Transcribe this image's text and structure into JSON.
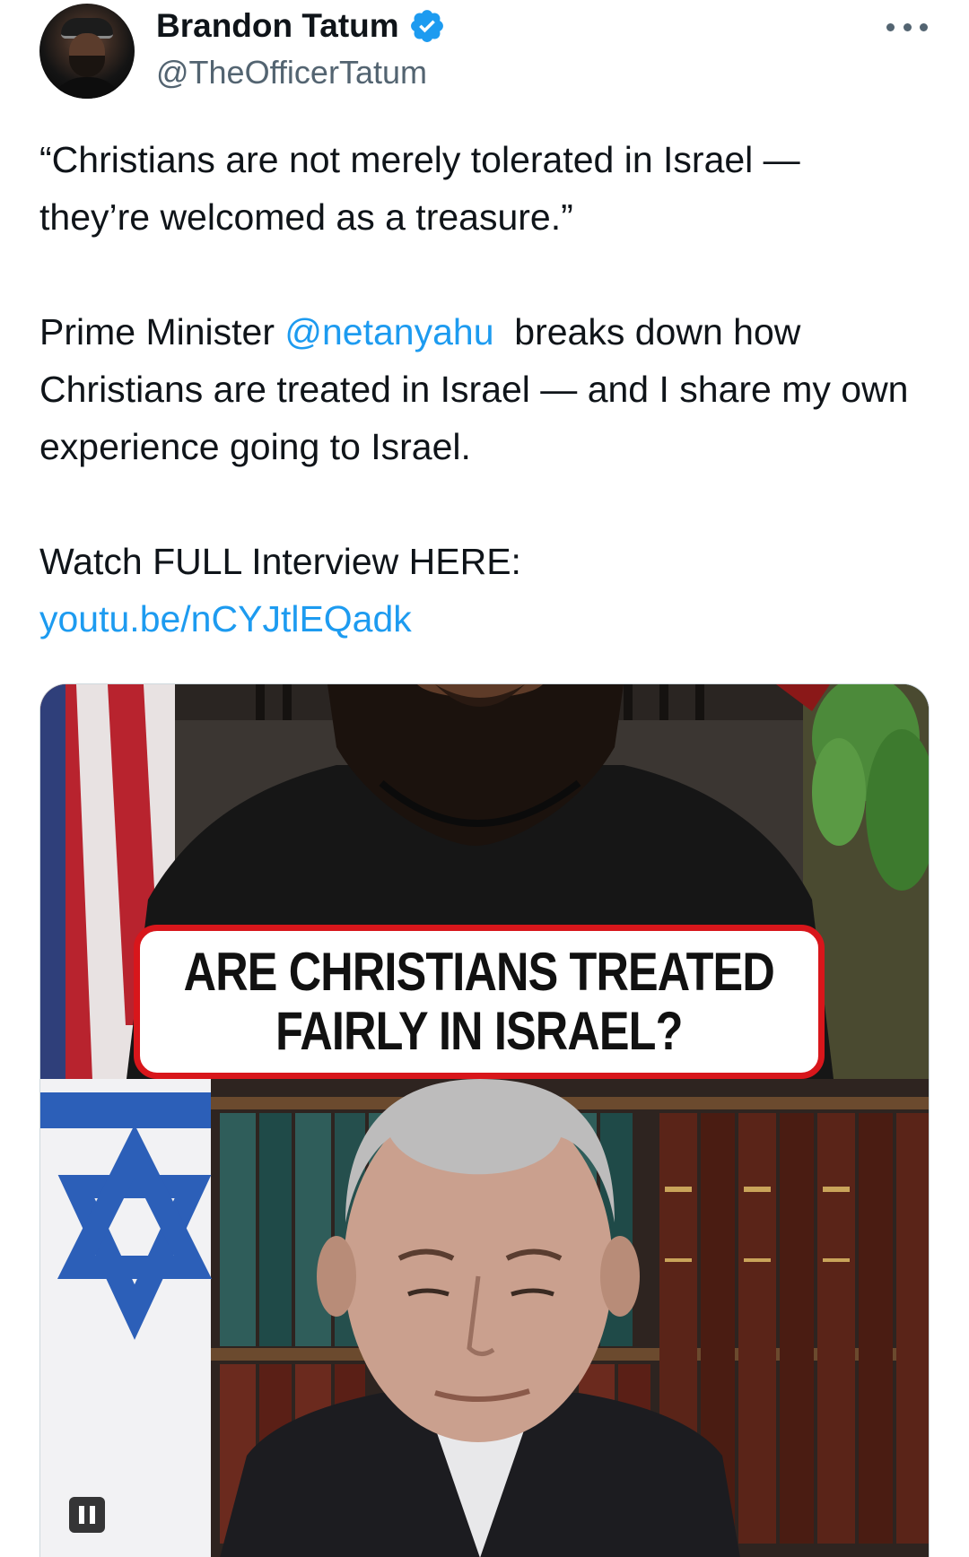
{
  "author": {
    "display_name": "Brandon Tatum",
    "handle": "@TheOfficerTatum",
    "verified": true,
    "verified_color": "#1d9bf0"
  },
  "tweet": {
    "quote_line1": "“Christians are not merely tolerated in Israel —",
    "quote_line2": "they’re welcomed as a treasure.”",
    "para2_prefix": "Prime Minister ",
    "mention": "@netanyahu",
    "para2_suffix": "  breaks down how Christians are treated in Israel — and I share my own experience going to Israel.",
    "watch_text": "Watch FULL Interview HERE:",
    "link": "youtu.be/nCYJtlEQadk",
    "link_color": "#1d9bf0"
  },
  "media": {
    "caption_line1": "ARE CHRISTIANS TREATED",
    "caption_line2": "FAIRLY IN ISRAEL?",
    "caption_border_color": "#d8161b",
    "playing": true
  },
  "icons": {
    "more": "more-horizontal-icon",
    "verified": "verified-badge-icon",
    "pause": "pause-icon"
  }
}
